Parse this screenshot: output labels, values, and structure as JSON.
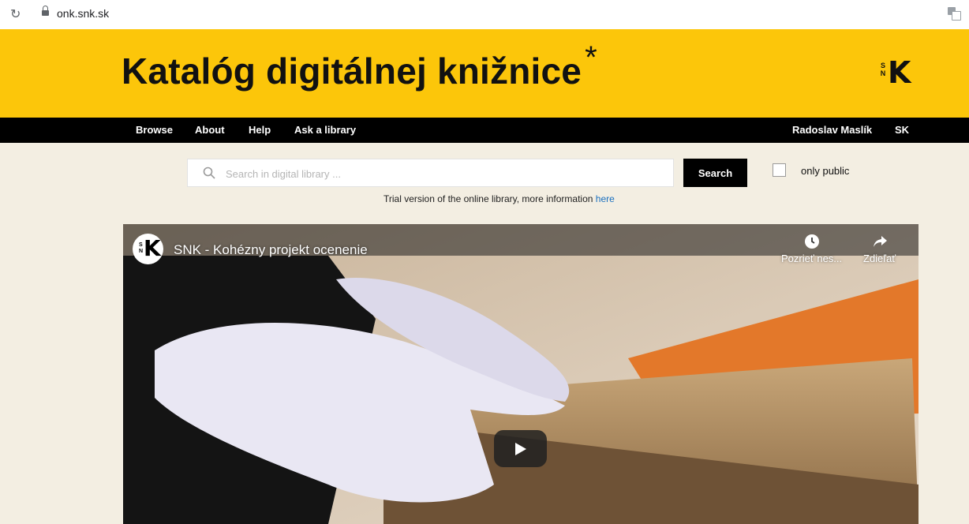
{
  "browser": {
    "reload_icon": "↻",
    "url": "onk.snk.sk"
  },
  "header": {
    "title": "Katalóg digitálnej knižnice",
    "title_star": "*",
    "logo_letters_top": "S",
    "logo_letters_bottom": "N",
    "logo_k": "K",
    "background": "#fcc60a"
  },
  "nav": {
    "items": [
      {
        "label": "Browse"
      },
      {
        "label": "About"
      },
      {
        "label": "Help"
      },
      {
        "label": "Ask a library"
      }
    ],
    "user": "Radoslav Maslík",
    "language": "SK"
  },
  "search": {
    "placeholder": "Search in digital library ...",
    "value": "",
    "button_label": "Search",
    "only_public_label": "only public",
    "only_public_checked": false
  },
  "notice": {
    "text": "Trial version of the online library, more information ",
    "link_text": "here"
  },
  "video": {
    "title": "SNK - Kohézny projekt ocenenie",
    "channel_sn_top": "S",
    "channel_sn_bottom": "N",
    "channel_k": "K",
    "watch_later_label": "Pozrieť nes...",
    "share_label": "Zdieľať"
  }
}
